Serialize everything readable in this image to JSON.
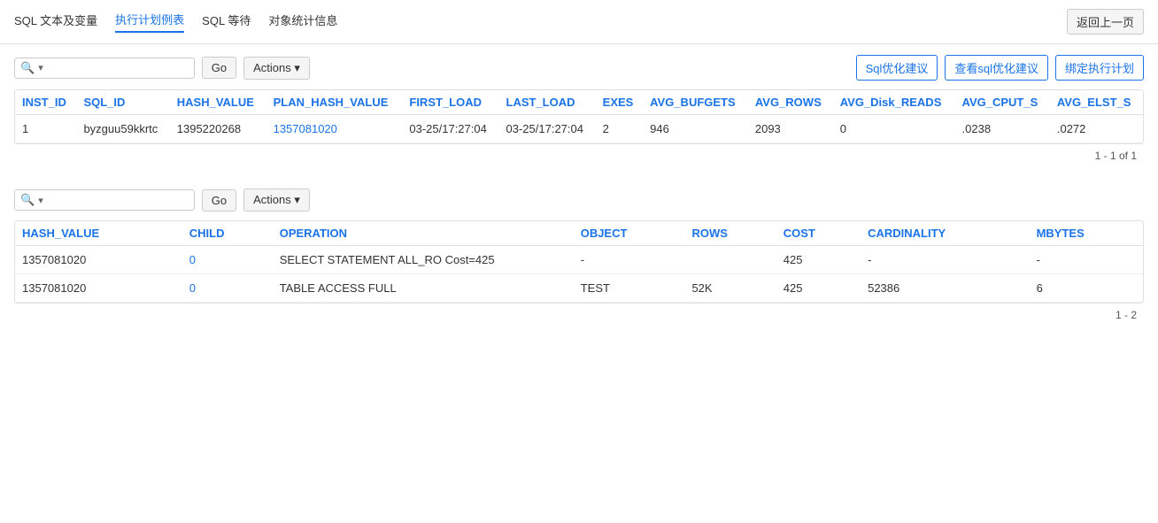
{
  "tabs": [
    {
      "label": "SQL 文本及变量",
      "active": false
    },
    {
      "label": "执行计划例表",
      "active": true
    },
    {
      "label": "SQL 等待",
      "active": false
    },
    {
      "label": "对象统计信息",
      "active": false
    }
  ],
  "back_button": "返回上一页",
  "section1": {
    "search_placeholder": "",
    "go_label": "Go",
    "actions_label": "Actions",
    "buttons": [
      {
        "label": "Sql优化建议"
      },
      {
        "label": "查看sql优化建议"
      },
      {
        "label": "绑定执行计划"
      }
    ],
    "columns": [
      "INST_ID",
      "SQL_ID",
      "HASH_VALUE",
      "PLAN_HASH_VALUE",
      "FIRST_LOAD",
      "LAST_LOAD",
      "EXES",
      "AVG_BUFGETS",
      "AVG_ROWS",
      "AVG_Disk_READS",
      "AVG_CPUT_S",
      "AVG_ELST_S"
    ],
    "rows": [
      {
        "inst_id": "1",
        "sql_id": "byzguu59kkrtc",
        "hash_value": "1395220268",
        "plan_hash_value": "1357081020",
        "first_load": "03-25/17:27:04",
        "last_load": "03-25/17:27:04",
        "exes": "2",
        "avg_bufgets": "946",
        "avg_rows": "2093",
        "avg_disk_reads": "0",
        "avg_cput_s": ".0238",
        "avg_elst_s": ".0272"
      }
    ],
    "pagination": "1 - 1 of 1"
  },
  "section2": {
    "search_placeholder": "",
    "go_label": "Go",
    "actions_label": "Actions",
    "columns": [
      "HASH_VALUE",
      "CHILD",
      "OPERATION",
      "OBJECT",
      "ROWS",
      "COST",
      "CARDINALITY",
      "MBYTES"
    ],
    "rows": [
      {
        "hash_value": "1357081020",
        "child": "0",
        "operation": "SELECT STATEMENT  ALL_RO  Cost=425",
        "object": "-",
        "rows": "",
        "cost": "425",
        "cardinality": "-",
        "mbytes": "-"
      },
      {
        "hash_value": "1357081020",
        "child": "0",
        "operation": "TABLE  ACCESS  FULL",
        "object": "TEST",
        "rows": "52K",
        "cost": "425",
        "cardinality": "52386",
        "mbytes": "6"
      }
    ],
    "pagination": "1 - 2"
  }
}
